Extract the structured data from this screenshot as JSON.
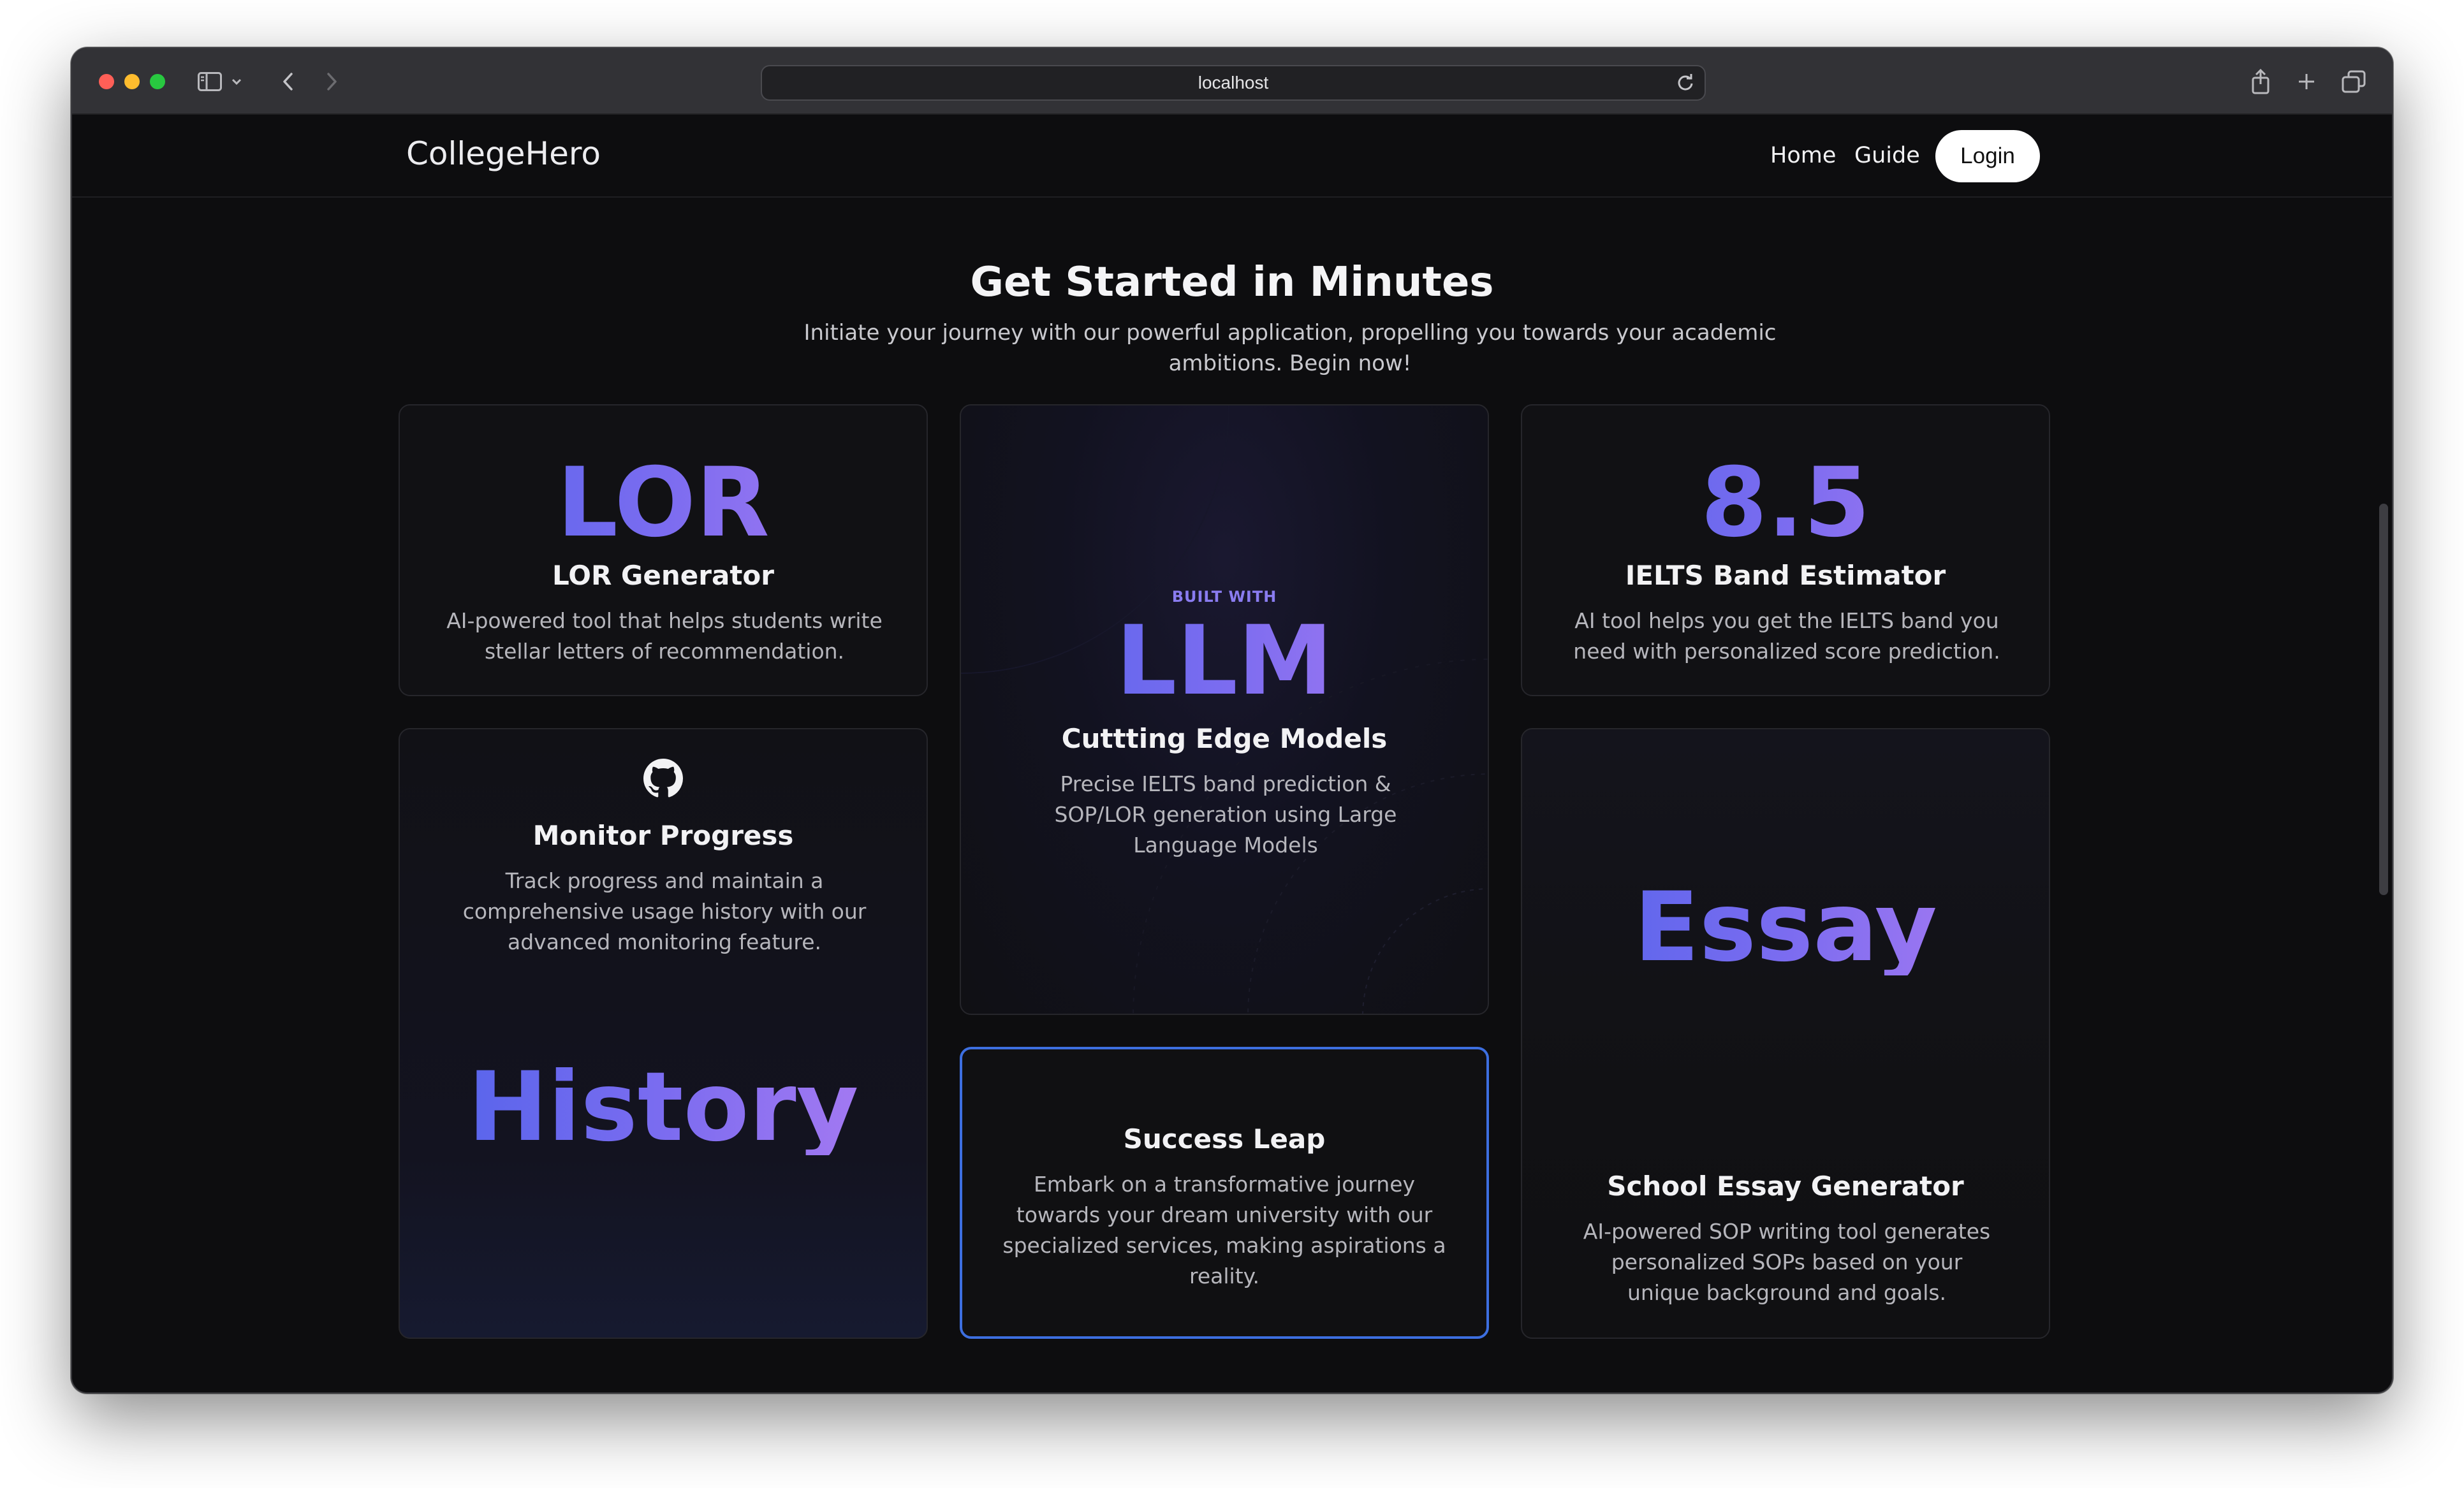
{
  "browser": {
    "address": "localhost"
  },
  "nav": {
    "brand": "CollegeHero",
    "links": [
      "Home",
      "Guide"
    ],
    "login": "Login"
  },
  "hero": {
    "title": "Get Started in Minutes",
    "subtitle": "Initiate your journey with our powerful application, propelling you towards your academic ambitions. Begin now!"
  },
  "cards": {
    "lor": {
      "big": "LOR",
      "title": "LOR Generator",
      "desc": "AI-powered tool that helps students write stellar letters of recommendation."
    },
    "llm": {
      "eyebrow": "BUILT WITH",
      "big": "LLM",
      "title": "Cuttting Edge Models",
      "desc": "Precise IELTS band prediction & SOP/LOR generation using Large Language Models"
    },
    "ielts": {
      "big": "8.5",
      "title": "IELTS Band Estimator",
      "desc": "AI tool helps you get the IELTS band you need with personalized score prediction."
    },
    "progress": {
      "icon": "github-icon",
      "title": "Monitor Progress",
      "desc": "Track progress and maintain a comprehensive usage history with our advanced monitoring feature.",
      "big": "History"
    },
    "success": {
      "title": "Success Leap",
      "desc": "Embark on a transformative journey towards your dream university with our specialized services, making aspirations a reality."
    },
    "essay": {
      "big": "Essay",
      "title": "School Essay Generator",
      "desc": "AI-powered SOP writing tool generates personalized SOPs based on your unique background and goals."
    }
  },
  "colors": {
    "accent_blue": "#4f63ea",
    "accent_purple": "#b07df2",
    "highlight_border": "#3d6fe0"
  }
}
